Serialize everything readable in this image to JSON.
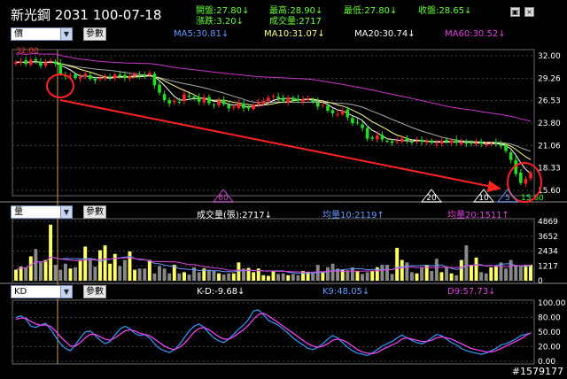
{
  "stock": {
    "name": "新光鋼",
    "code": "2031",
    "date": "100-07-18"
  },
  "quote": {
    "open": "開盤:27.80↓",
    "high": "最高:28.90↓",
    "low": "最低:27.80↓",
    "close": "收盤:28.65↓",
    "change": "漲跌:3.20↓",
    "volume": "成交量:2717"
  },
  "window_buttons": {
    "restore": "▣",
    "close": "×"
  },
  "price_panel": {
    "selector": "價",
    "param_button": "參數",
    "ma5": "MA5:30.81↓",
    "ma10": "MA10:31.07↓",
    "ma20": "MA20:30.74↓",
    "ma60": "MA60:30.52↓",
    "high_label": "32.00",
    "low_label": "15.60",
    "axis_ticks": [
      "32.00",
      "29.26",
      "26.53",
      "23.80",
      "21.06",
      "18.33",
      "15.60"
    ],
    "period_markers": [
      "60",
      "20",
      "10",
      "5"
    ]
  },
  "volume_panel": {
    "selector": "量",
    "param_button": "參數",
    "volume": "成交量(張):2717↓",
    "avg10": "均量10:2119↑",
    "avg20": "均量20:1511↑",
    "axis_ticks": [
      "4869",
      "3652",
      "2434",
      "1217",
      "0"
    ]
  },
  "kd_panel": {
    "selector": "KD",
    "param_button": "參數",
    "kd": "K-D:-9.68↓",
    "k": "K9:48.05↓",
    "d": "D9:57.73↓",
    "axis_ticks": [
      "100.00",
      "80.00",
      "50.00",
      "20.00",
      "0.00"
    ]
  },
  "watermark": "#1579177",
  "colors": {
    "up": "#ff2222",
    "down": "#22dd22",
    "flat": "#ffffff",
    "vol_up": "#ffff66",
    "vol_down": "#888888",
    "ma5": "#ffffff",
    "ma10": "#ffff88",
    "ma20": "#aaaaaa",
    "ma60": "#cc33cc",
    "k": "#3399ff",
    "d": "#ff44ff",
    "arrow": "#ff2222"
  },
  "chart_data": [
    {
      "type": "candlestick",
      "title": "新光鋼 2031 100-07-18",
      "ylim": [
        15.6,
        32.0
      ],
      "high_marker": 32.0,
      "low_marker": 15.6,
      "closes": [
        31.2,
        31.3,
        31.0,
        31.5,
        31.4,
        30.8,
        31.2,
        31.4,
        31.0,
        29.8,
        29.5,
        29.6,
        29.3,
        29.4,
        29.8,
        29.2,
        29.0,
        29.3,
        29.4,
        29.4,
        29.7,
        29.5,
        29.3,
        29.5,
        29.8,
        29.6,
        29.5,
        29.9,
        28.4,
        27.5,
        26.6,
        26.2,
        26.5,
        26.4,
        27.3,
        27.0,
        26.8,
        26.4,
        26.9,
        26.2,
        26.0,
        26.5,
        26.1,
        25.6,
        25.8,
        26.2,
        25.6,
        25.6,
        26.0,
        26.3,
        26.5,
        26.9,
        27.1,
        26.8,
        26.5,
        26.9,
        26.6,
        26.5,
        26.7,
        26.8,
        26.4,
        25.8,
        26.0,
        25.3,
        25.0,
        24.9,
        25.3,
        24.5,
        23.8,
        23.8,
        23.2,
        21.9,
        21.9,
        22.3,
        21.8,
        21.6,
        21.4,
        21.6,
        21.9,
        21.7,
        21.5,
        21.6,
        21.5,
        21.6,
        21.4,
        21.3,
        21.6,
        21.5,
        21.7,
        21.4,
        21.5,
        21.3,
        21.3,
        21.4,
        21.3,
        21.2,
        21.3,
        21.3,
        21.0,
        20.4,
        19.3,
        17.6,
        16.5,
        17.0,
        17.8
      ],
      "ma5": 30.81,
      "ma10": 31.07,
      "ma20": 30.74,
      "ma60": 30.52
    },
    {
      "type": "bar",
      "ylim": [
        0,
        4869
      ],
      "values": [
        900,
        1150,
        1100,
        2000,
        2600,
        1500,
        1700,
        4600,
        1300,
        900,
        1400,
        1000,
        1100,
        1700,
        2800,
        1800,
        1150,
        2500,
        2900,
        1400,
        2200,
        1200,
        1700,
        2400,
        900,
        1000,
        1000,
        1700,
        600,
        1200,
        1000,
        600,
        1300,
        600,
        700,
        500,
        1100,
        700,
        1000,
        900,
        800,
        600,
        500,
        600,
        600,
        1500,
        1000,
        1050,
        700,
        1000,
        450,
        400,
        800,
        550,
        600,
        450,
        550,
        450,
        800,
        700,
        700,
        1300,
        700,
        1100,
        1400,
        1000,
        900,
        850,
        1100,
        800,
        550,
        700,
        800,
        1100,
        1300,
        1300,
        550,
        2700,
        1700,
        1500,
        700,
        600,
        1100,
        1300,
        800,
        1800,
        700,
        1100,
        600,
        450,
        1700,
        2900,
        1300,
        1900,
        700,
        600,
        1100,
        1200,
        1500,
        1000,
        1700,
        1300,
        1200,
        1300,
        1300
      ],
      "avg10": 2119,
      "avg20": 1511
    },
    {
      "type": "line",
      "ylim": [
        0,
        100
      ],
      "series": [
        {
          "name": "K9",
          "values": [
            75,
            78,
            72,
            60,
            58,
            62,
            65,
            55,
            42,
            30,
            22,
            18,
            28,
            40,
            50,
            52,
            44,
            36,
            30,
            34,
            45,
            55,
            60,
            56,
            48,
            44,
            46,
            40,
            30,
            22,
            18,
            15,
            20,
            28,
            40,
            52,
            60,
            64,
            58,
            48,
            40,
            35,
            32,
            38,
            46,
            55,
            62,
            72,
            86,
            88,
            80,
            70,
            66,
            62,
            55,
            48,
            40,
            34,
            28,
            22,
            20,
            24,
            30,
            38,
            44,
            40,
            32,
            24,
            18,
            14,
            12,
            10,
            14,
            20,
            26,
            30,
            34,
            40,
            45,
            40,
            36,
            32,
            30,
            34,
            40,
            46,
            44,
            38,
            32,
            28,
            22,
            18,
            16,
            14,
            12,
            14,
            18,
            22,
            28,
            30,
            34,
            38,
            44,
            46,
            48
          ]
        },
        {
          "name": "D9",
          "values": [
            72,
            74,
            74,
            68,
            64,
            62,
            62,
            60,
            52,
            42,
            34,
            26,
            26,
            32,
            40,
            46,
            46,
            42,
            38,
            36,
            40,
            46,
            52,
            54,
            52,
            48,
            46,
            44,
            38,
            32,
            26,
            22,
            20,
            24,
            30,
            40,
            50,
            56,
            58,
            54,
            48,
            42,
            38,
            38,
            42,
            48,
            54,
            62,
            72,
            80,
            82,
            78,
            72,
            66,
            60,
            54,
            48,
            42,
            36,
            30,
            26,
            24,
            26,
            30,
            36,
            38,
            36,
            32,
            26,
            20,
            16,
            14,
            13,
            15,
            20,
            24,
            28,
            32,
            38,
            40,
            38,
            36,
            34,
            34,
            36,
            40,
            42,
            40,
            38,
            34,
            30,
            26,
            22,
            20,
            18,
            16,
            16,
            18,
            22,
            26,
            30,
            34,
            38,
            44,
            49
          ]
        }
      ]
    }
  ]
}
